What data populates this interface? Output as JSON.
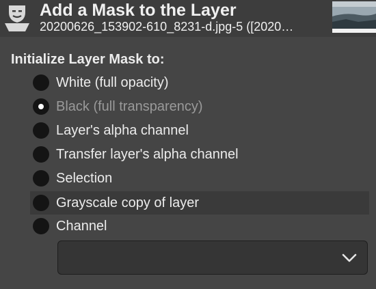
{
  "header": {
    "title": "Add a Mask to the Layer",
    "subtitle": "20200626_153902-610_8231-d.jpg-5 ([2020…",
    "icon": "layer-mask-icon"
  },
  "section_label": "Initialize Layer Mask to:",
  "options": [
    {
      "label": "White (full opacity)",
      "checked": false,
      "sensitive": true
    },
    {
      "label": "Black (full transparency)",
      "checked": true,
      "sensitive": false
    },
    {
      "label": "Layer's alpha channel",
      "checked": false,
      "sensitive": true
    },
    {
      "label": "Transfer layer's alpha channel",
      "checked": false,
      "sensitive": true
    },
    {
      "label": "Selection",
      "checked": false,
      "sensitive": true
    },
    {
      "label": "Grayscale copy of layer",
      "checked": false,
      "sensitive": true,
      "hover": true
    },
    {
      "label": "Channel",
      "checked": false,
      "sensitive": true
    }
  ],
  "channel_select": {
    "value": "",
    "icon": "chevron-down-icon"
  },
  "colors": {
    "background": "#454545",
    "header_background": "#3d3d3d",
    "radio_fill": "#141414",
    "text": "#ececec",
    "insensitive_text": "#9a9a9a"
  }
}
